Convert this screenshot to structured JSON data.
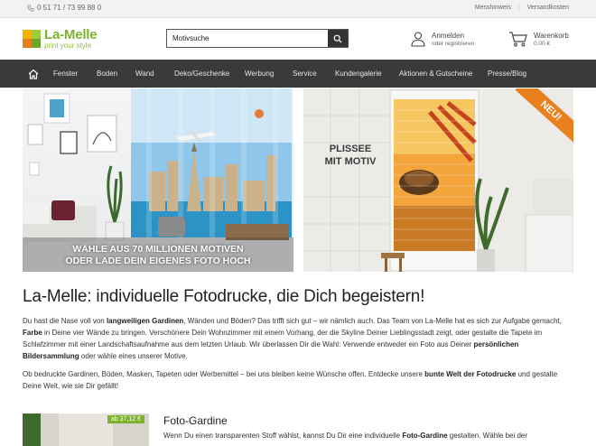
{
  "topbar": {
    "phone": "0 51 71 / 73 99 88 0",
    "links": [
      "Messhinweis",
      "Versandkosten"
    ]
  },
  "header": {
    "logo_name": "La-Melle",
    "logo_claim": "print your style",
    "search_value": "Motivsuche",
    "account_title": "Anmelden",
    "account_sub": "oder registrieren",
    "cart_title": "Warenkorb",
    "cart_sub": "0,00 €"
  },
  "nav": {
    "items": [
      "Fenster",
      "Boden",
      "Wand",
      "Deko/Geschenke",
      "Werbung",
      "Service",
      "Kundengalerie",
      "Aktionen & Gutscheine",
      "Presse/Blog"
    ]
  },
  "banners": {
    "left_caption_1": "WÄHLE AUS 70 MILLIONEN MOTIVEN",
    "left_caption_2": "ODER LADE DEIN EIGENES FOTO HOCH",
    "right_caption_1": "PLISSEE",
    "right_caption_2": "MIT MOTIV",
    "right_badge": "NEU!"
  },
  "main": {
    "title": "La-Melle: individuelle Fotodrucke, die Dich begeistern!",
    "p1": {
      "t1": "Du hast die Nase voll von ",
      "b1": "langweiligen Gardinen",
      "t2": ", Wänden und Böden? Das trifft sich gut – wir nämlich auch. Das Team von La-Melle hat es sich zur Aufgabe gemacht, ",
      "b2": "Farbe",
      "t3": " in Deine vier Wände zu bringen. Verschönere Dein Wohnzimmer mit einem Vorhang, der die Skyline Deiner Lieblingsstadt zeigt, oder gestalte die Tapete im Schlafzimmer mit einer Landschaftsaufnahme aus dem letzten Urlaub. Wir überlassen Dir die Wahl: Verwende entweder ein Foto aus Deiner ",
      "b3": "persönlichen Bildersammlung",
      "t4": " oder wähle eines unserer Motive."
    },
    "p2": {
      "t1": "Ob bedruckte Gardinen, Böden, Masken, Tapeten oder Werbemittel – bei uns bleiben keine Wünsche offen. Entdecke unsere ",
      "b1": "bunte Welt der Fotodrucke",
      "t2": " und gestalte Deine Welt, wie sie Dir gefällt!"
    }
  },
  "product": {
    "price": "ab 37,12 €",
    "title": "Foto-Gardine",
    "t1": "Wenn Du einen transparenten Stoff wählst, kannst Du Dir eine individuelle ",
    "b1": "Foto-Gardine",
    "t2": " gestalten. Wähle bei der"
  },
  "colors": {
    "brand_green": "#7bb32e",
    "nav_bg": "#3a3a3a",
    "badge_orange": "#e8801e"
  }
}
